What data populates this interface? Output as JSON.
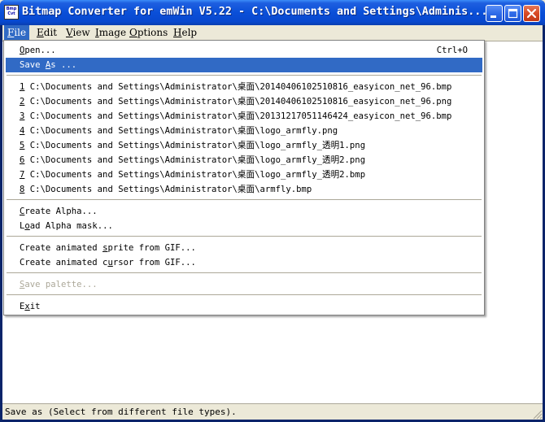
{
  "window": {
    "title": "Bitmap Converter for emWin V5.22 - C:\\Documents and Settings\\Adminis...",
    "icon_text": "Bmp Cvt"
  },
  "menubar": {
    "items": [
      {
        "label": "File",
        "accel": "F",
        "rest": "ile"
      },
      {
        "label": "Edit",
        "accel": "E",
        "rest": "dit"
      },
      {
        "label": "View",
        "accel": "V",
        "rest": "iew"
      },
      {
        "label": "Image",
        "accel": "I",
        "rest": "mage"
      },
      {
        "label": "Options",
        "accel": "O",
        "rest": "ptions"
      },
      {
        "label": "Help",
        "accel": "H",
        "rest": "elp"
      }
    ]
  },
  "file_menu": {
    "open": {
      "accel": "O",
      "rest": "pen...",
      "shortcut": "Ctrl+O"
    },
    "save_as": {
      "pre": "Save ",
      "accel": "A",
      "rest": "s ..."
    },
    "recent": [
      {
        "num": "1",
        "path": " C:\\Documents and Settings\\Administrator\\桌面\\20140406102510816_easyicon_net_96.bmp"
      },
      {
        "num": "2",
        "path": " C:\\Documents and Settings\\Administrator\\桌面\\20140406102510816_easyicon_net_96.png"
      },
      {
        "num": "3",
        "path": " C:\\Documents and Settings\\Administrator\\桌面\\20131217051146424_easyicon_net_96.bmp"
      },
      {
        "num": "4",
        "path": " C:\\Documents and Settings\\Administrator\\桌面\\logo_armfly.png"
      },
      {
        "num": "5",
        "path": " C:\\Documents and Settings\\Administrator\\桌面\\logo_armfly_透明1.png"
      },
      {
        "num": "6",
        "path": " C:\\Documents and Settings\\Administrator\\桌面\\logo_armfly_透明2.png"
      },
      {
        "num": "7",
        "path": " C:\\Documents and Settings\\Administrator\\桌面\\logo_armfly_透明2.bmp"
      },
      {
        "num": "8",
        "path": " C:\\Documents and Settings\\Administrator\\桌面\\armfly.bmp"
      }
    ],
    "create_alpha": {
      "accel": "C",
      "rest": "reate Alpha..."
    },
    "load_alpha": {
      "pre": "L",
      "accel": "o",
      "rest": "ad Alpha mask..."
    },
    "create_sprite": {
      "pre": "Create animated ",
      "accel": "s",
      "rest": "prite from GIF..."
    },
    "create_cursor": {
      "pre": "Create animated c",
      "accel": "u",
      "rest": "rsor from GIF..."
    },
    "save_palette": {
      "accel": "S",
      "rest": "ave palette..."
    },
    "exit": {
      "pre": "E",
      "accel": "x",
      "rest": "it"
    }
  },
  "statusbar": {
    "text": "Save as (Select from different file types)."
  },
  "colors": {
    "menu_highlight": "#316ac5",
    "titlebar": "#0a4fd8",
    "face": "#ece9d8"
  }
}
